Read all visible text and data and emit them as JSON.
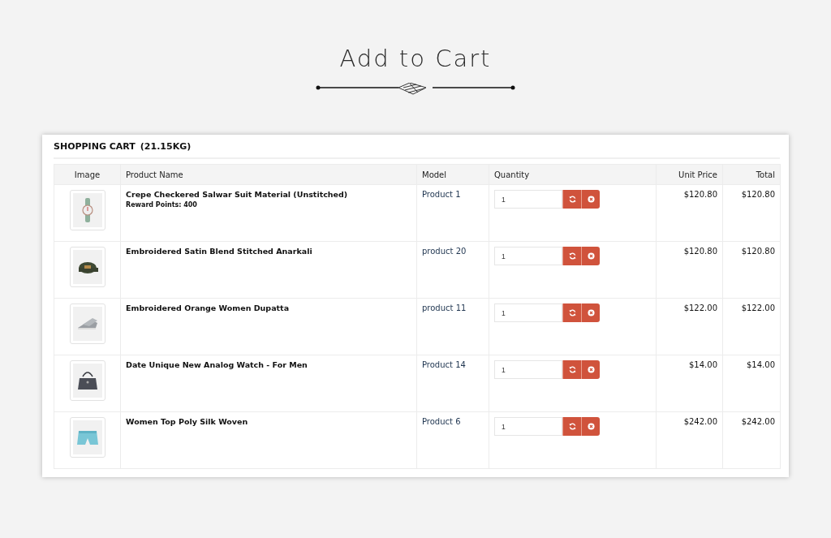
{
  "page_title": "Add to Cart",
  "cart": {
    "title": "SHOPPING CART",
    "weight": "(21.15KG)",
    "columns": [
      "Image",
      "Product Name",
      "Model",
      "Quantity",
      "Unit Price",
      "Total"
    ],
    "rows": [
      {
        "name": "Crepe Checkered Salwar Suit Material (Unstitched)",
        "reward": "Reward Points: 400",
        "model": "Product 1",
        "quantity": "1",
        "unit_price": "$120.80",
        "total": "$120.80"
      },
      {
        "name": "Embroidered Satin Blend Stitched Anarkali",
        "model": "product 20",
        "quantity": "1",
        "unit_price": "$120.80",
        "total": "$120.80"
      },
      {
        "name": "Embroidered Orange Women Dupatta",
        "model": "product 11",
        "quantity": "1",
        "unit_price": "$122.00",
        "total": "$122.00"
      },
      {
        "name": "Date Unique New Analog Watch - For Men",
        "model": "Product 14",
        "quantity": "1",
        "unit_price": "$14.00",
        "total": "$14.00"
      },
      {
        "name": "Women Top Poly Silk Woven",
        "model": "Product 6",
        "quantity": "1",
        "unit_price": "$242.00",
        "total": "$242.00"
      }
    ]
  }
}
